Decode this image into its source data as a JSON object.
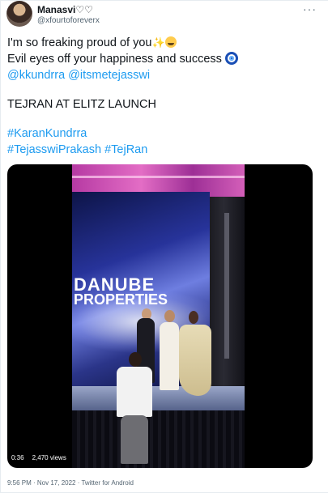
{
  "author": {
    "display_name": "Manasvi♡♡",
    "handle": "@xfourtoforeverx"
  },
  "tweet": {
    "line1": "I'm so freaking proud of you",
    "line2": "Evil eyes off your happiness and success",
    "mention1": "@kkundrra",
    "mention2": "@itsmetejasswi",
    "line4": "TEJRAN AT ELITZ LAUNCH",
    "hashtag1": "#KaranKundrra",
    "hashtag2": "#TejasswiPrakash",
    "hashtag3": "#TejRan"
  },
  "media": {
    "logo_line1": "DANUBE",
    "logo_line2": "PROPERTIES",
    "duration": "0:36",
    "views": "2,470 views"
  },
  "footer": {
    "timestamp": "9:56 PM · Nov 17, 2022 · Twitter for Android"
  },
  "icons": {
    "more": "more-icon",
    "sparkle": "sparkles-icon",
    "cry": "crying-face-icon",
    "nazar": "nazar-amulet-icon"
  }
}
